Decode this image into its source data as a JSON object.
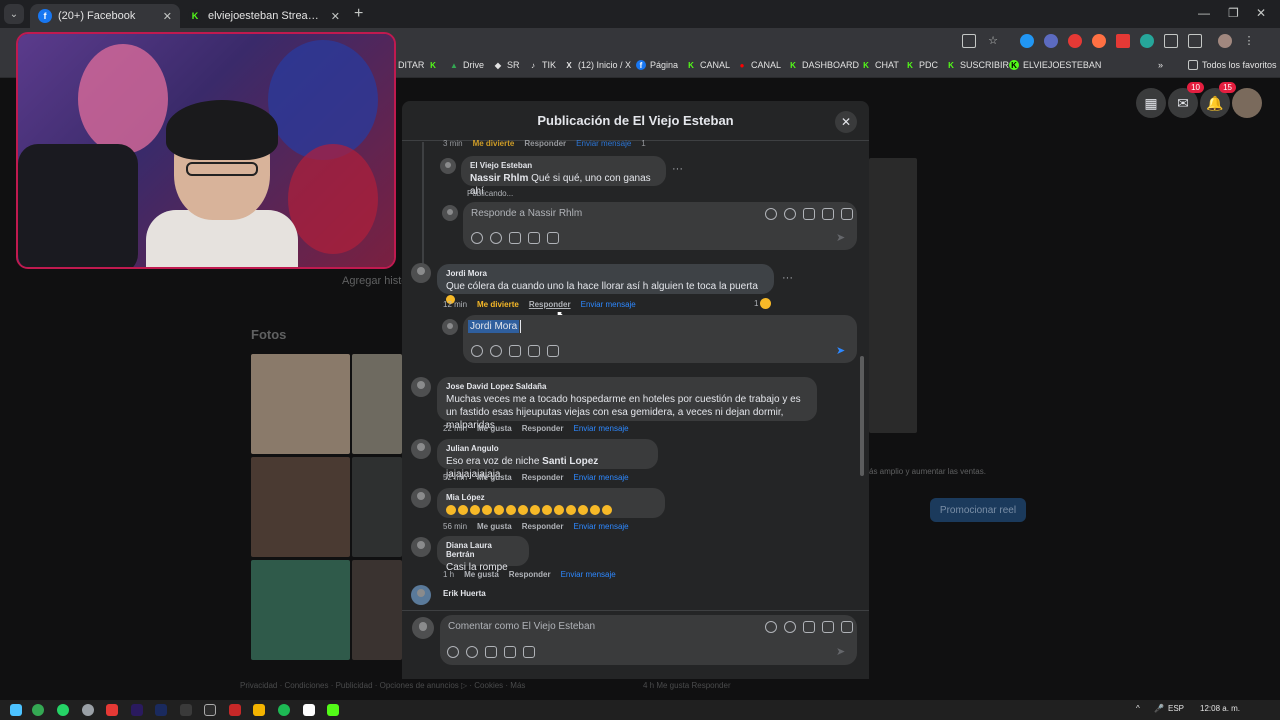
{
  "browser": {
    "tabs": [
      {
        "title": "(20+) Facebook",
        "active": true
      },
      {
        "title": "elviejoesteban Stream - Watch",
        "active": false
      }
    ],
    "new_tab": "+",
    "tab_search": "⌄",
    "window_controls": [
      "—",
      "❐",
      "✕"
    ],
    "bookmarks": [
      {
        "label": "DITAR",
        "icon": ""
      },
      {
        "label": "",
        "icon": "kick-icon"
      },
      {
        "label": "Drive",
        "icon": "drive-icon"
      },
      {
        "label": "SR",
        "icon": "sr-icon"
      },
      {
        "label": "TIK",
        "icon": "tiktok-icon"
      },
      {
        "label": "(12) Inicio / X",
        "icon": "x-icon"
      },
      {
        "label": "Página",
        "icon": "facebook-icon"
      },
      {
        "label": "CANAL",
        "icon": "kick-icon"
      },
      {
        "label": "CANAL",
        "icon": "youtube-icon"
      },
      {
        "label": "DASHBOARD",
        "icon": "kick-icon"
      },
      {
        "label": "CHAT",
        "icon": "kick-icon"
      },
      {
        "label": "PDC",
        "icon": "kick-icon"
      },
      {
        "label": "SUSCRIBIR",
        "icon": "kick-icon"
      },
      {
        "label": "ELVIEJOESTEBAN",
        "icon": "kick-icon"
      }
    ],
    "all_bookmarks": "Todos los favoritos",
    "bookmarks_overflow": "»"
  },
  "facebook": {
    "messenger_badge": "10",
    "notifications_badge": "15",
    "bg_add_history": "Agregar histo",
    "photos_title": "Fotos",
    "promo_text": "ás amplio y aumentar las ventas.",
    "promo_button": "Promocionar reel",
    "footer": "Privacidad · Condiciones · Publicidad · Opciones de anuncios ▷ · Cookies · Más",
    "bg_right_footer": "4 h    Me gusta    Responder"
  },
  "modal": {
    "title": "Publicación de El Viejo Esteban",
    "close": "✕",
    "top_meta": {
      "time": "3 min",
      "react": "Me divierte",
      "reply": "Responder",
      "message": "Enviar mensaje",
      "count": "1"
    },
    "nested_reply": {
      "author": "El Viejo Esteban",
      "mention": "Nassir Rhlm",
      "text": " Qué si qué, uno con ganas ahí",
      "status": "Publicando..."
    },
    "reply_placeholder_1": "Responde a Nassir Rhlm",
    "comments": [
      {
        "author": "Jordi Mora",
        "text": "Que cólera da cuando uno la hace llorar así h alguien te toca la puerta",
        "time": "12 min",
        "react": "Me divierte",
        "reply": "Responder",
        "message": "Enviar mensaje",
        "reactions": "1"
      },
      {
        "author": "Jose David Lopez Saldaña",
        "text": "Muchas veces me a tocado hospedarme en hoteles por cuestión de trabajo y es un fastido esas hijeuputas viejas con esa gemidera, a veces ni dejan dormir, malparidas",
        "time": "22 min",
        "like": "Me gusta",
        "reply": "Responder",
        "message": "Enviar mensaje"
      },
      {
        "author": "Julian Angulo",
        "text_prefix": "Eso era voz de niche ",
        "mention": "Santi Lopez",
        "text_suffix": " jajajajajajaja",
        "time": "52 min",
        "like": "Me gusta",
        "reply": "Responder",
        "message": "Enviar mensaje"
      },
      {
        "author": "Mia López",
        "emoji_count": 14,
        "time": "56 min",
        "like": "Me gusta",
        "reply": "Responder",
        "message": "Enviar mensaje"
      },
      {
        "author": "Diana Laura Bertrán",
        "text": "Casi la rompe",
        "time": "1 h",
        "like": "Me gusta",
        "reply": "Responder",
        "message": "Enviar mensaje"
      },
      {
        "author": "Erik Huerta"
      }
    ],
    "reply_mention_2": "Jordi Mora",
    "comment_placeholder": "Comentar como El Viejo Esteban",
    "more": "···"
  },
  "taskbar": {
    "lang": "ESP",
    "time": "12:08 a. m."
  },
  "colors": {
    "accent": "#2d88ff",
    "react": "#f7b928",
    "webcam_border": "#c01a4f"
  }
}
